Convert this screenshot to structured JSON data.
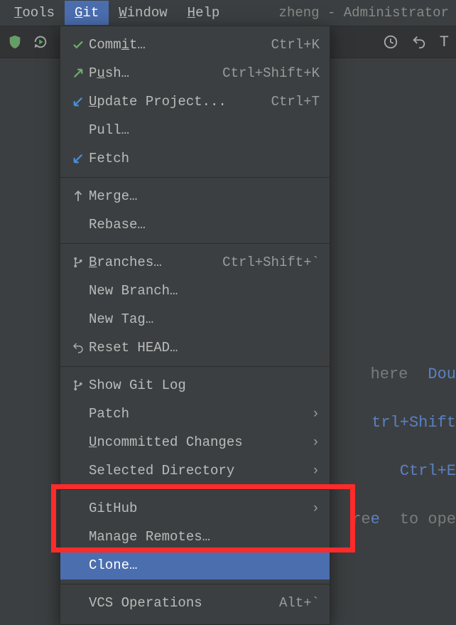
{
  "menubar": {
    "tools": "Tools",
    "git": "Git",
    "window": "Window",
    "help": "Help",
    "title": "zheng - Administrator"
  },
  "menu": {
    "commit": {
      "label": "Commit…",
      "shortcut": "Ctrl+K"
    },
    "push": {
      "label": "Push…",
      "shortcut": "Ctrl+Shift+K"
    },
    "update": {
      "label": "Update Project...",
      "shortcut": "Ctrl+T"
    },
    "pull": {
      "label": "Pull…"
    },
    "fetch": {
      "label": "Fetch"
    },
    "merge": {
      "label": "Merge…"
    },
    "rebase": {
      "label": "Rebase…"
    },
    "branches": {
      "label": "Branches…",
      "shortcut": "Ctrl+Shift+`"
    },
    "newbranch": {
      "label": "New Branch…"
    },
    "newtag": {
      "label": "New Tag…"
    },
    "resethead": {
      "label": "Reset HEAD…"
    },
    "showlog": {
      "label": "Show Git Log"
    },
    "patch": {
      "label": "Patch"
    },
    "uncommitted": {
      "label": "Uncommitted Changes"
    },
    "seldir": {
      "label": "Selected Directory"
    },
    "github": {
      "label": "GitHub"
    },
    "manageremotes": {
      "label": "Manage Remotes…"
    },
    "clone": {
      "label": "Clone…"
    },
    "vcsops": {
      "label": "VCS Operations",
      "shortcut": "Alt+`"
    }
  },
  "hints": {
    "h1text": "here",
    "h1key": "Dou",
    "h2key": "trl+Shift",
    "h3key": "Ctrl+E",
    "h4a": "re",
    "h4b": "to ope"
  }
}
